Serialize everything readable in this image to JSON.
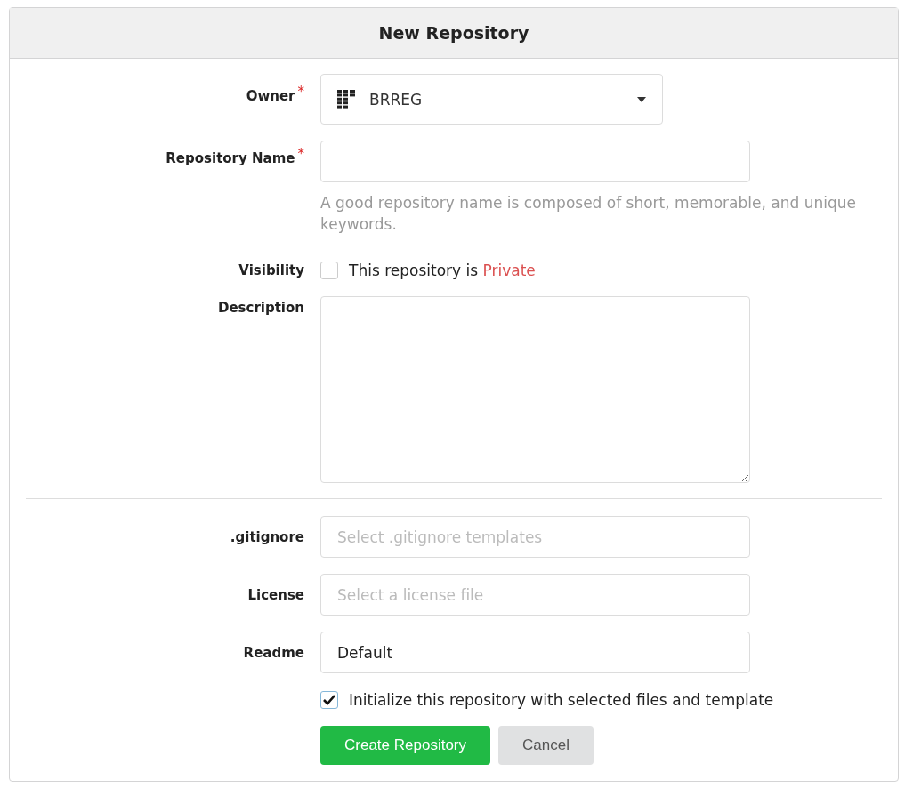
{
  "title": "New Repository",
  "owner": {
    "label": "Owner",
    "required_mark": "*",
    "value": "BRREG"
  },
  "repository_name": {
    "label": "Repository Name",
    "required_mark": "*",
    "help": "A good repository name is composed of short, memorable, and unique keywords."
  },
  "visibility": {
    "label": "Visibility",
    "checked": false,
    "text": "This repository is ",
    "highlight": "Private"
  },
  "description": {
    "label": "Description"
  },
  "templates": [
    {
      "label": ".gitignore",
      "placeholder": "Select .gitignore templates"
    },
    {
      "label": "License",
      "placeholder": "Select a license file"
    },
    {
      "label": "Readme",
      "value": "Default"
    }
  ],
  "initialize": {
    "checked": true,
    "text": "Initialize this repository with selected files and template"
  },
  "buttons": [
    {
      "label": "Create Repository",
      "kind": "primary"
    },
    {
      "label": "Cancel",
      "kind": "secondary"
    }
  ]
}
